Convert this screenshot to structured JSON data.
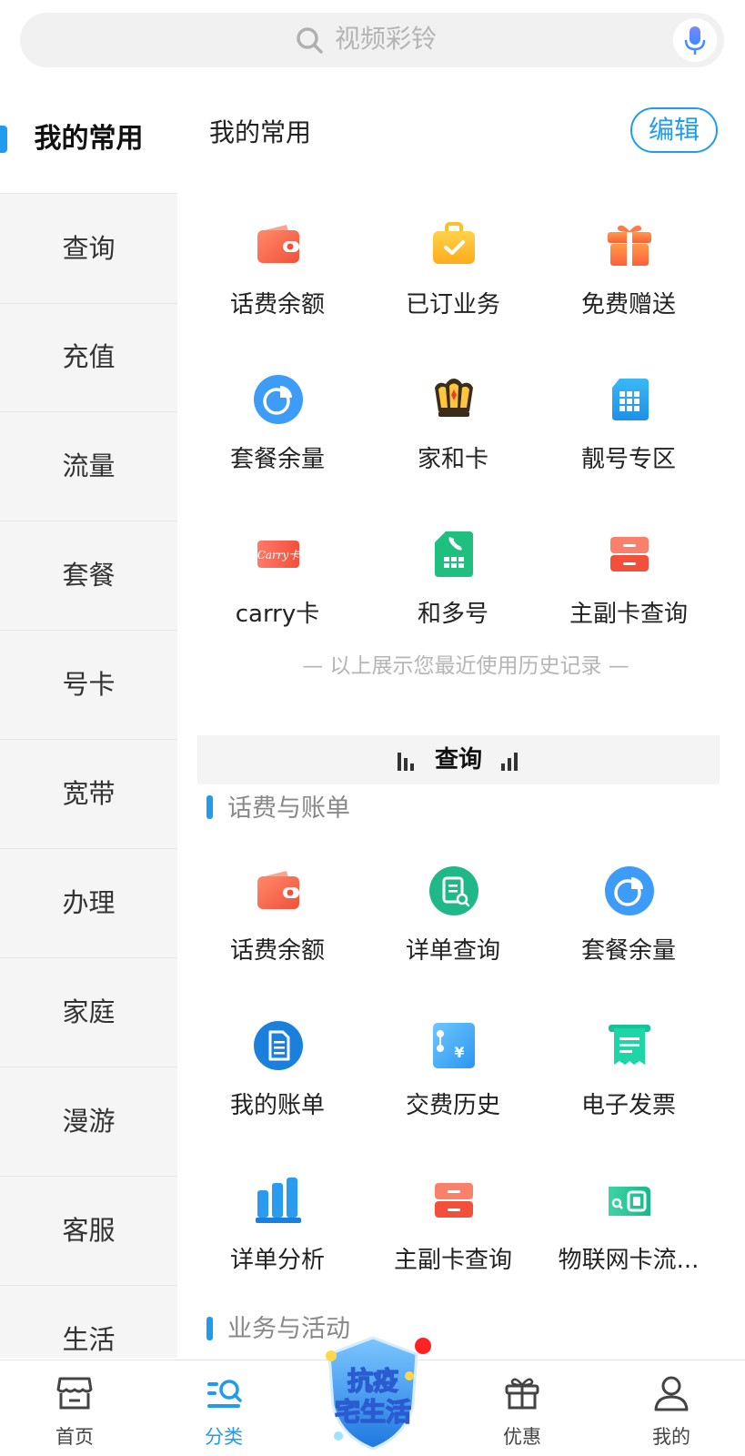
{
  "search": {
    "placeholder": "视频彩铃"
  },
  "sidebar": {
    "items": [
      {
        "label": "我的常用"
      },
      {
        "label": "查询"
      },
      {
        "label": "充值"
      },
      {
        "label": "流量"
      },
      {
        "label": "套餐"
      },
      {
        "label": "号卡"
      },
      {
        "label": "宽带"
      },
      {
        "label": "办理"
      },
      {
        "label": "家庭"
      },
      {
        "label": "漫游"
      },
      {
        "label": "客服"
      },
      {
        "label": "生活"
      }
    ]
  },
  "favorites": {
    "title": "我的常用",
    "edit_label": "编辑",
    "items": [
      {
        "label": "话费余额",
        "icon": "wallet-icon"
      },
      {
        "label": "已订业务",
        "icon": "briefcase-check-icon"
      },
      {
        "label": "免费赠送",
        "icon": "gift-icon"
      },
      {
        "label": "套餐余量",
        "icon": "pie-chart-icon"
      },
      {
        "label": "家和卡",
        "icon": "crown-icon"
      },
      {
        "label": "靓号专区",
        "icon": "sim-card-icon"
      },
      {
        "label": "carry卡",
        "icon": "carry-card-icon"
      },
      {
        "label": "和多号",
        "icon": "phone-sim-icon"
      },
      {
        "label": "主副卡查询",
        "icon": "drawer-icon"
      }
    ],
    "history_note": "— 以上展示您最近使用历史记录 —"
  },
  "query_section": {
    "title": "查询",
    "subsection_title": "话费与账单",
    "items": [
      {
        "label": "话费余额",
        "icon": "wallet-icon"
      },
      {
        "label": "详单查询",
        "icon": "document-search-icon"
      },
      {
        "label": "套餐余量",
        "icon": "pie-chart-icon"
      },
      {
        "label": "我的账单",
        "icon": "bill-icon"
      },
      {
        "label": "交费历史",
        "icon": "payment-history-icon"
      },
      {
        "label": "电子发票",
        "icon": "invoice-icon"
      },
      {
        "label": "详单分析",
        "icon": "bar-chart-icon"
      },
      {
        "label": "主副卡查询",
        "icon": "drawer-icon"
      },
      {
        "label": "物联网卡流...",
        "icon": "iot-card-icon"
      }
    ],
    "next_subsection_title": "业务与活动"
  },
  "bottom_nav": {
    "items": [
      {
        "label": "首页",
        "icon": "home-store-icon"
      },
      {
        "label": "分类",
        "icon": "category-search-icon"
      },
      {
        "label": "优惠",
        "icon": "gift-box-icon"
      },
      {
        "label": "我的",
        "icon": "user-icon"
      }
    ],
    "promo": {
      "line1": "抗疫",
      "line2": "宅生活"
    }
  },
  "colors": {
    "accent": "#1f9cf0",
    "notification": "#ff2222"
  }
}
